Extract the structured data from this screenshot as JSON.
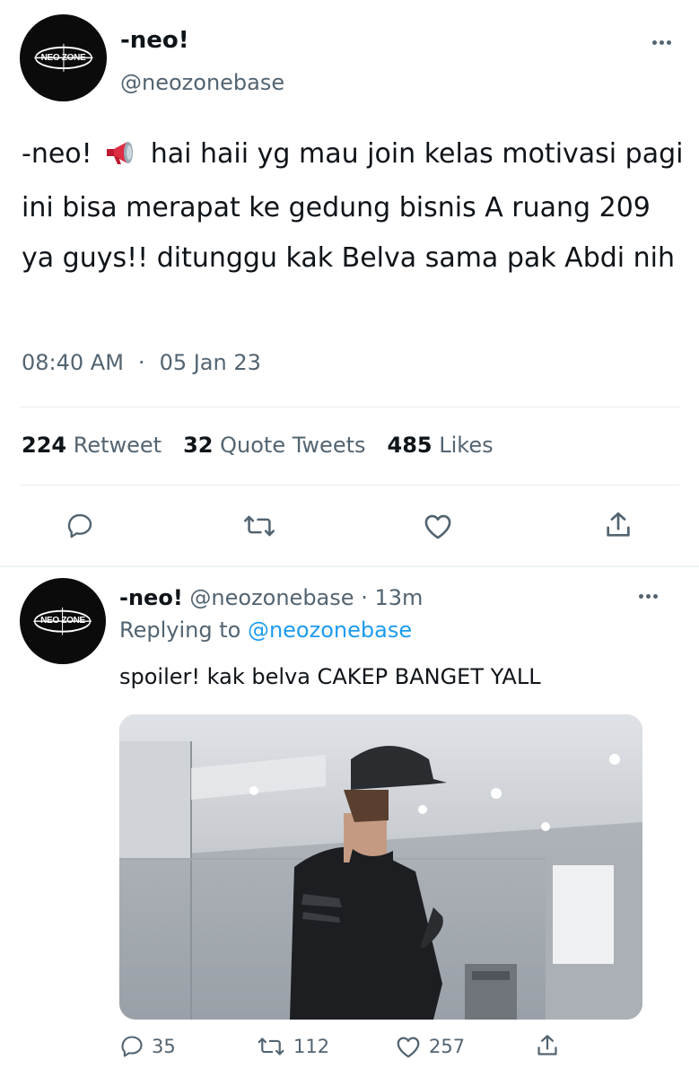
{
  "tweet": {
    "display_name": "-neo!",
    "handle": "@neozonebase",
    "avatar_logo_text": "NEO ZONE",
    "text_prefix": "-neo!",
    "text_body": " hai haii yg mau join kelas motivasi pagi ini bisa merapat ke gedung bisnis A ruang 209 ya guys!! ditunggu kak Belva sama pak Abdi nih",
    "emoji_icon": "megaphone-icon",
    "time": "08:40 AM",
    "separator": "·",
    "date": "05 Jan 23",
    "stats": {
      "retweets_count": "224",
      "retweets_label": "Retweet",
      "quotes_count": "32",
      "quotes_label": "Quote Tweets",
      "likes_count": "485",
      "likes_label": "Likes"
    },
    "actions": [
      "reply-icon",
      "retweet-icon",
      "like-icon",
      "share-icon"
    ]
  },
  "reply": {
    "display_name": "-neo!",
    "handle": "@neozonebase",
    "separator": "·",
    "time_ago": "13m",
    "replying_to_label": "Replying to",
    "replying_to_handle": "@neozonebase",
    "text": "spoiler! kak belva CAKEP BANGET YALL",
    "media_alt_icon": "photo-person-in-cap",
    "counts": {
      "replies": "35",
      "retweets": "112",
      "likes": "257"
    }
  },
  "colors": {
    "text": "#0f1419",
    "secondary": "#536471",
    "accent": "#1d9bf0",
    "divider": "#e6ecf0",
    "avatar_bg": "#0b0b0b"
  }
}
